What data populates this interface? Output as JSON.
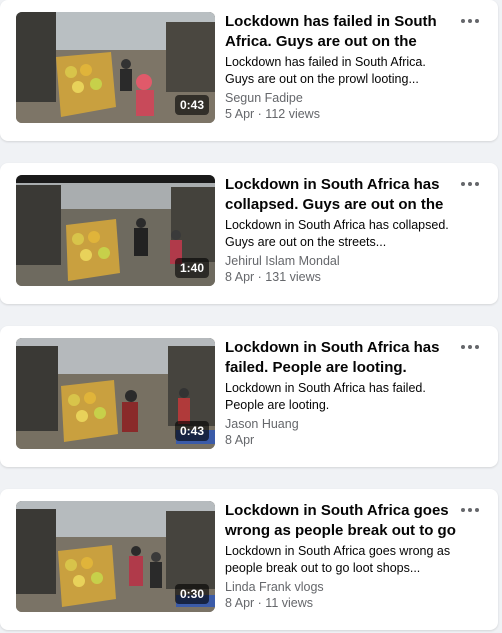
{
  "videos": [
    {
      "title": "Lockdown has failed in South Africa. Guys are out on the prowl looting...",
      "description": "Lockdown has failed in South Africa. Guys are out on the prowl looting...",
      "author": "Segun Fadipe",
      "meta": "5 Apr · 112 views",
      "duration": "0:43"
    },
    {
      "title": "Lockdown in South Africa has collapsed. Guys are out on the streets...",
      "description": "Lockdown in South Africa has collapsed. Guys are out on the streets...",
      "author": "Jehirul Islam Mondal",
      "meta": "8 Apr · 131 views",
      "duration": "1:40"
    },
    {
      "title": "Lockdown in South Africa has failed. People are looting.",
      "description": "Lockdown in South Africa has failed. People are looting.",
      "author": "Jason Huang",
      "meta": "8 Apr",
      "duration": "0:43"
    },
    {
      "title": "Lockdown in South Africa goes wrong as people break out to go loot shops...",
      "description": "Lockdown in South Africa goes wrong as people break out to go loot shops...",
      "author": "Linda Frank vlogs",
      "meta": "8 Apr · 11 views",
      "duration": "0:30"
    }
  ],
  "icons": {
    "more": "more-horizontal-icon",
    "thumbnail": "cctv-store-scene"
  },
  "colors": {
    "background": "#f0f2f5",
    "card": "#ffffff",
    "secondary_text": "#65676b"
  }
}
